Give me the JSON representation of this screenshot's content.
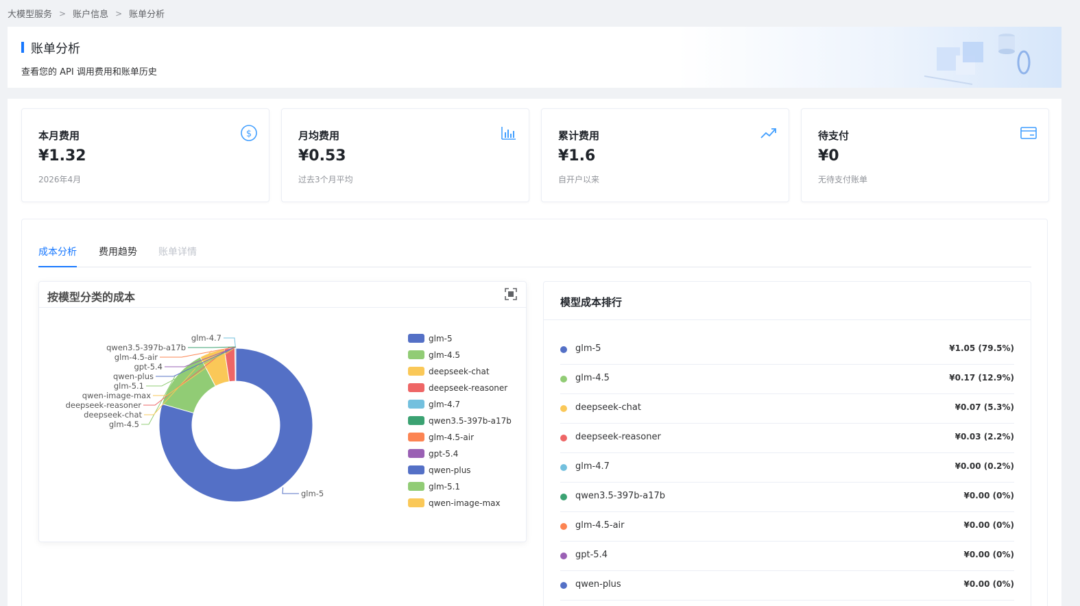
{
  "breadcrumb": [
    "大模型服务",
    "账户信息",
    "账单分析"
  ],
  "header": {
    "title": "账单分析",
    "subtitle": "查看您的 API 调用费用和账单历史"
  },
  "cards": [
    {
      "title": "本月费用",
      "value": "¥1.32",
      "sub": "2026年4月",
      "icon": "dollar-circle-icon",
      "color": "#409eff"
    },
    {
      "title": "月均费用",
      "value": "¥0.53",
      "sub": "过去3个月平均",
      "icon": "bar-chart-icon",
      "color": "#409eff"
    },
    {
      "title": "累计费用",
      "value": "¥1.6",
      "sub": "自开户以来",
      "icon": "trend-up-icon",
      "color": "#409eff"
    },
    {
      "title": "待支付",
      "value": "¥0",
      "sub": "无待支付账单",
      "icon": "credit-card-icon",
      "color": "#409eff"
    }
  ],
  "tabs": [
    {
      "label": "成本分析",
      "state": "active"
    },
    {
      "label": "费用趋势",
      "state": "normal"
    },
    {
      "label": "账单详情",
      "state": "disabled"
    }
  ],
  "cost_chart": {
    "title": "按模型分类的成本"
  },
  "chart_data": {
    "type": "pie",
    "donut": true,
    "legend_position": "right",
    "slices": [
      {
        "label": "glm-5",
        "value": 79.5,
        "color": "#5470c6"
      },
      {
        "label": "glm-4.5",
        "value": 12.9,
        "color": "#91cc75"
      },
      {
        "label": "deepseek-chat",
        "value": 5.3,
        "color": "#fac858"
      },
      {
        "label": "deepseek-reasoner",
        "value": 2.2,
        "color": "#ee6666"
      },
      {
        "label": "glm-4.7",
        "value": 0.2,
        "color": "#73c0de"
      },
      {
        "label": "qwen3.5-397b-a17b",
        "value": 0,
        "color": "#3ba272"
      },
      {
        "label": "glm-4.5-air",
        "value": 0,
        "color": "#fc8452"
      },
      {
        "label": "gpt-5.4",
        "value": 0,
        "color": "#9a60b4"
      },
      {
        "label": "qwen-plus",
        "value": 0,
        "color": "#5470c6"
      },
      {
        "label": "glm-5.1",
        "value": 0,
        "color": "#91cc75"
      },
      {
        "label": "qwen-image-max",
        "value": 0,
        "color": "#fac858"
      }
    ]
  },
  "ranking": {
    "title": "模型成本排行",
    "items": [
      {
        "name": "glm-5",
        "amount": "¥1.05 (79.5%)",
        "color": "#5470c6"
      },
      {
        "name": "glm-4.5",
        "amount": "¥0.17 (12.9%)",
        "color": "#91cc75"
      },
      {
        "name": "deepseek-chat",
        "amount": "¥0.07 (5.3%)",
        "color": "#fac858"
      },
      {
        "name": "deepseek-reasoner",
        "amount": "¥0.03 (2.2%)",
        "color": "#ee6666"
      },
      {
        "name": "glm-4.7",
        "amount": "¥0.00 (0.2%)",
        "color": "#73c0de"
      },
      {
        "name": "qwen3.5-397b-a17b",
        "amount": "¥0.00 (0%)",
        "color": "#3ba272"
      },
      {
        "name": "glm-4.5-air",
        "amount": "¥0.00 (0%)",
        "color": "#fc8452"
      },
      {
        "name": "gpt-5.4",
        "amount": "¥0.00 (0%)",
        "color": "#9a60b4"
      },
      {
        "name": "qwen-plus",
        "amount": "¥0.00 (0%)",
        "color": "#5470c6"
      }
    ]
  }
}
